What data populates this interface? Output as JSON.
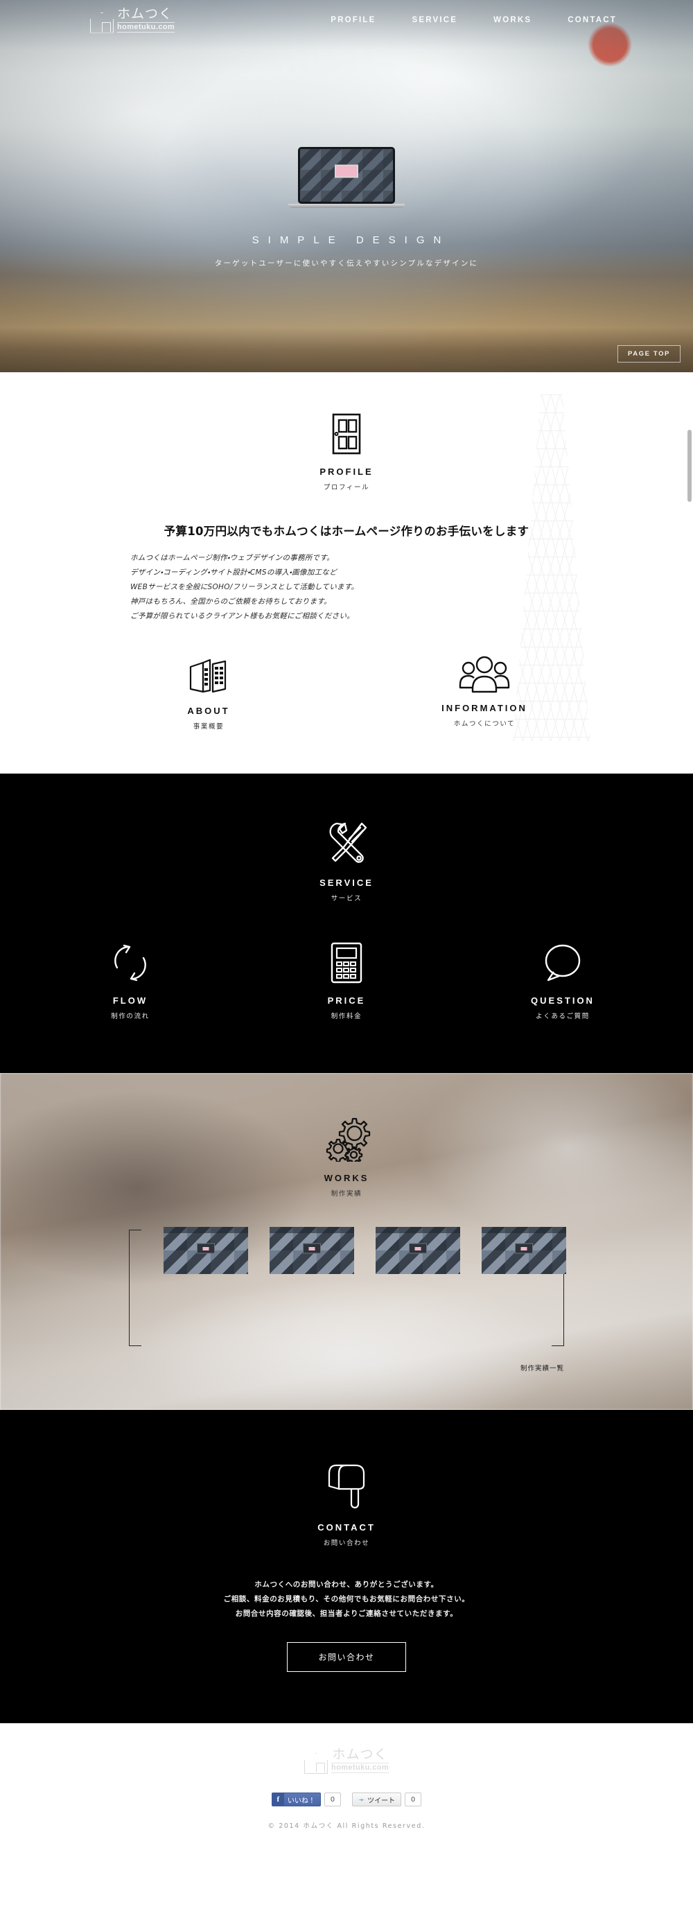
{
  "header": {
    "logo": {
      "jp": "ホムつく",
      "en": "hometuku.com",
      "icon": "house-icon"
    },
    "nav": [
      {
        "label": "PROFILE",
        "name": "nav-profile"
      },
      {
        "label": "SERVICE",
        "name": "nav-service"
      },
      {
        "label": "WORKS",
        "name": "nav-works"
      },
      {
        "label": "CONTACT",
        "name": "nav-contact"
      }
    ]
  },
  "hero": {
    "title": "SIMPLE DESIGN",
    "subtitle": "ターゲットユーザーに使いやすく伝えやすいシンプルなデザインに",
    "page_top_label": "PAGE TOP",
    "device_icon": "laptop-icon"
  },
  "profile": {
    "icon": "door-icon",
    "title": "PROFILE",
    "subtitle": "プロフィール",
    "heading": "予算10万円以内でもホムつくはホームページ作りのお手伝いをします",
    "body": [
      "ホムつくはホームページ制作・ウェブデザインの事務所です。",
      "デザイン・コーディング・サイト設計・CMSの導入・画像加工など",
      "WEBサービスを全般にSOHO/フリーランスとして活動しています。",
      "神戸はもちろん、全国からのご依頼をお待ちしております。",
      "ご予算が限られているクライアント様もお気軽にご相談ください。"
    ],
    "links": [
      {
        "icon": "buildings-icon",
        "title": "ABOUT",
        "subtitle": "事業概要"
      },
      {
        "icon": "people-icon",
        "title": "INFORMATION",
        "subtitle": "ホムつくについて"
      }
    ]
  },
  "service": {
    "icon": "wrench-screwdriver-icon",
    "title": "SERVICE",
    "subtitle": "サービス",
    "items": [
      {
        "icon": "refresh-arrows-icon",
        "title": "FLOW",
        "subtitle": "制作の流れ"
      },
      {
        "icon": "calculator-icon",
        "title": "PRICE",
        "subtitle": "制作料金"
      },
      {
        "icon": "speech-bubble-icon",
        "title": "QUESTION",
        "subtitle": "よくあるご質問"
      }
    ]
  },
  "works": {
    "icon": "gears-icon",
    "title": "WORKS",
    "subtitle": "制作実績",
    "caption": "制作実績一覧",
    "thumbnails": [
      {
        "name": "work-thumb-1"
      },
      {
        "name": "work-thumb-2"
      },
      {
        "name": "work-thumb-3"
      },
      {
        "name": "work-thumb-4"
      }
    ]
  },
  "contact": {
    "icon": "mailbox-icon",
    "title": "CONTACT",
    "subtitle": "お問い合わせ",
    "body": [
      "ホムつくへのお問い合わせ、ありがとうございます。",
      "ご相談、料金のお見積もり、その他何でもお気軽にお問合わせ下さい。",
      "お問合せ内容の確認後、担当者よりご連絡させていただきます。"
    ],
    "button_label": "お問い合わせ"
  },
  "footer": {
    "logo": {
      "jp": "ホムつく",
      "en": "hometuku.com"
    },
    "facebook": {
      "label": "いいね！",
      "count": "0",
      "icon": "facebook-icon"
    },
    "twitter": {
      "label": "ツイート",
      "count": "0",
      "icon": "twitter-icon"
    },
    "copyright": "© 2014 ホムつく All Rights Reserved."
  },
  "colors": {
    "dark": "#000000",
    "light": "#ffffff",
    "accent_pink": "#f0b8c8",
    "facebook_blue": "#3b5998",
    "twitter_blue": "#55acee"
  }
}
